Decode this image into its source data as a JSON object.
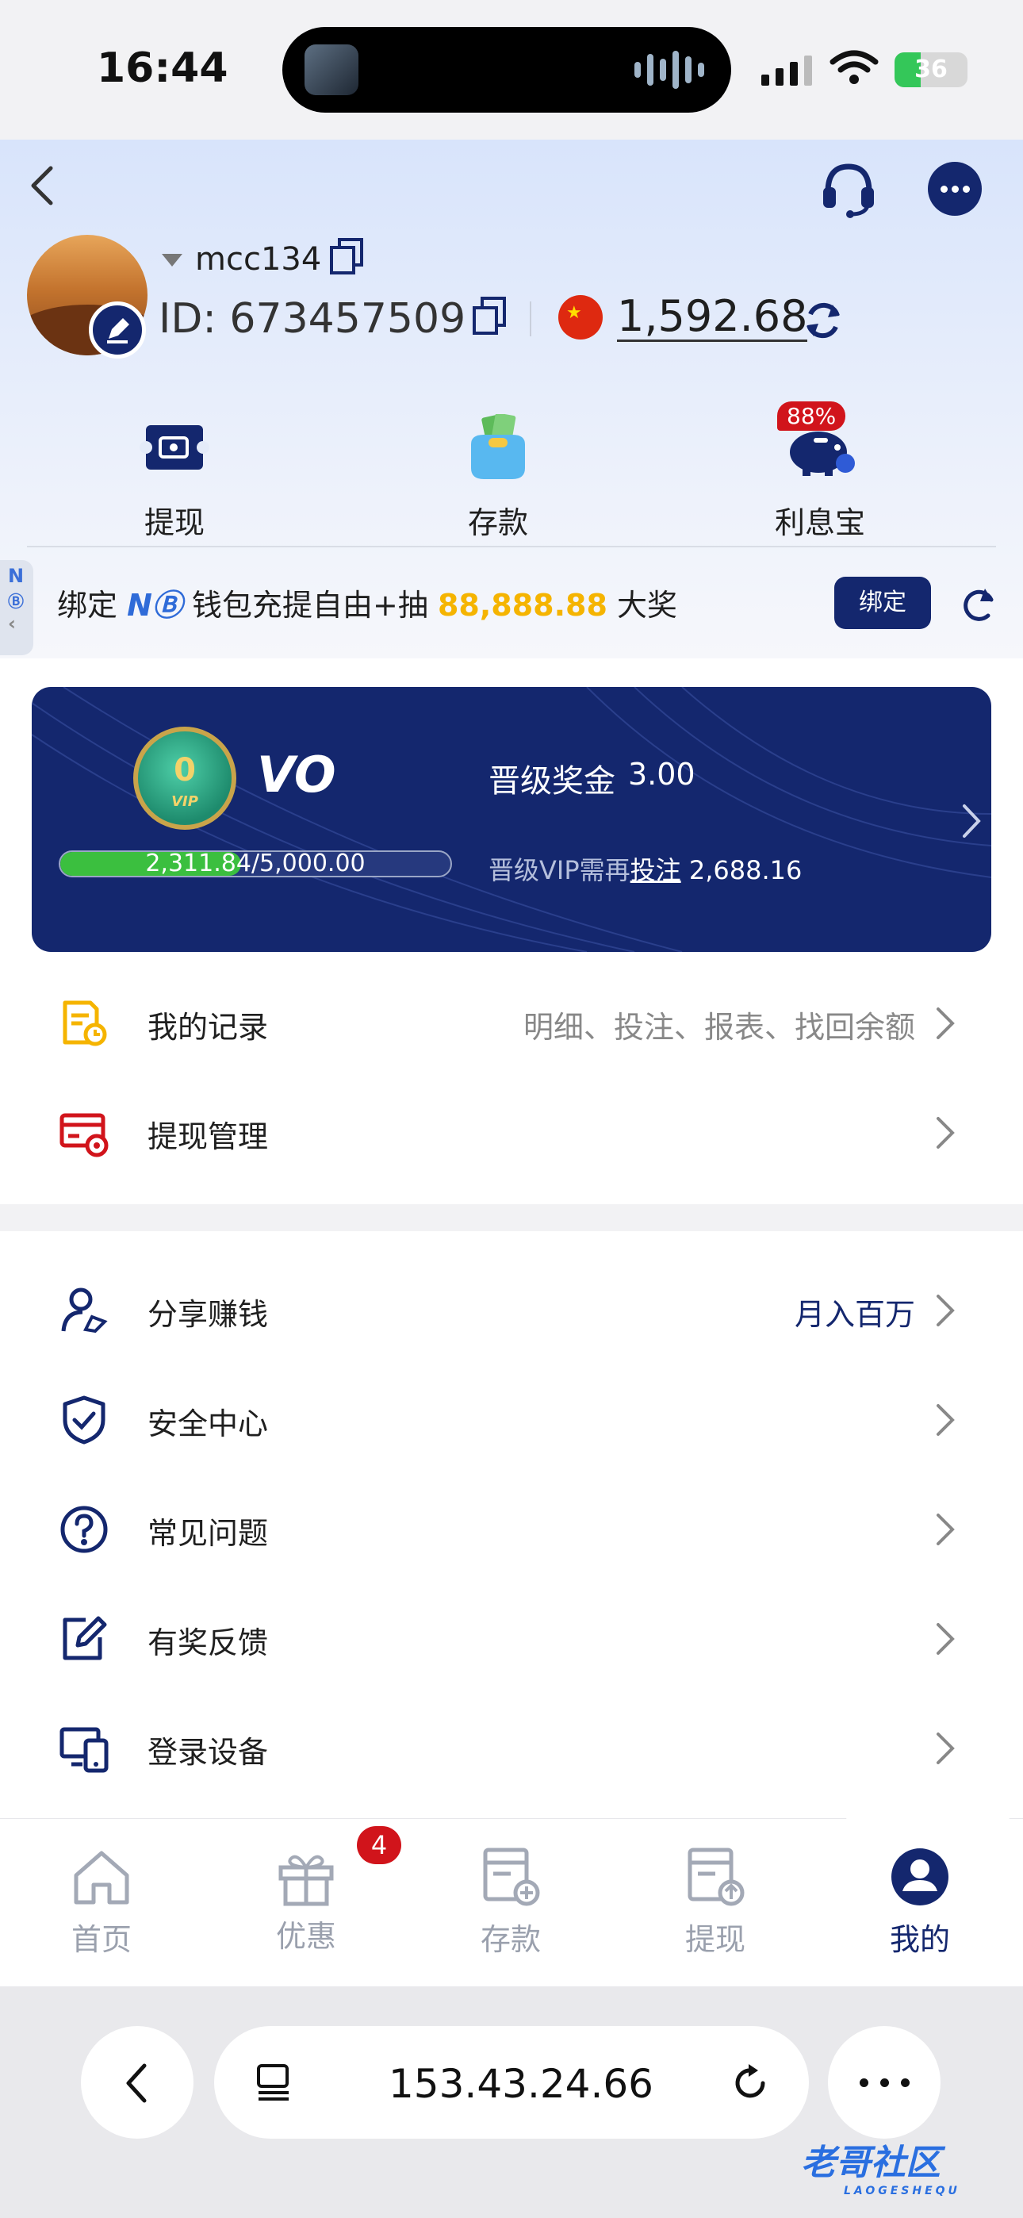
{
  "status": {
    "time": "16:44",
    "battery": "36"
  },
  "header": {
    "username": "mcc134",
    "id_text": "ID: 673457509",
    "balance": "1,592.68",
    "quick_actions": [
      {
        "label": "提现",
        "icon": "withdraw-ticket-icon"
      },
      {
        "label": "存款",
        "icon": "deposit-wallet-icon"
      },
      {
        "label": "利息宝",
        "icon": "piggy-bank-icon",
        "badge": "88%"
      }
    ],
    "promo": {
      "prefix": "绑定",
      "brand": "N",
      "middle": "钱包充提自由+抽",
      "amount": "88,888.88",
      "suffix": "大奖",
      "bind_label": "绑定"
    },
    "side_tab": "N"
  },
  "vip": {
    "medal_number": "0",
    "medal_text": "VIP",
    "level": "VO",
    "progress_text": "2,311.84/5,000.00",
    "progress_value": 0.4624,
    "bonus_label": "晋级奖金",
    "bonus_value": "3.00",
    "need_prefix": "晋级VIP需再",
    "need_link": "投注",
    "need_value": "2,688.16"
  },
  "menu_group_1": [
    {
      "label": "我的记录",
      "hint": "明细、投注、报表、找回余额",
      "icon": "records-icon"
    },
    {
      "label": "提现管理",
      "hint": "",
      "icon": "withdraw-manage-icon"
    }
  ],
  "menu_group_2": [
    {
      "label": "分享赚钱",
      "hint": "月入百万",
      "icon": "share-earn-icon"
    },
    {
      "label": "安全中心",
      "hint": "",
      "icon": "shield-check-icon"
    },
    {
      "label": "常见问题",
      "hint": "",
      "icon": "question-icon"
    },
    {
      "label": "有奖反馈",
      "hint": "",
      "icon": "feedback-edit-icon"
    },
    {
      "label": "登录设备",
      "hint": "",
      "icon": "devices-icon"
    }
  ],
  "tabbar": [
    {
      "label": "首页",
      "icon": "home-icon"
    },
    {
      "label": "优惠",
      "icon": "gift-icon",
      "badge": "4"
    },
    {
      "label": "存款",
      "icon": "deposit-card-icon"
    },
    {
      "label": "提现",
      "icon": "withdraw-card-icon"
    },
    {
      "label": "我的",
      "icon": "profile-icon",
      "active": true
    }
  ],
  "browser": {
    "url": "153.43.24.66"
  },
  "watermark": {
    "title": "老哥社区",
    "subtitle": "LAOGESHEQU"
  },
  "colors": {
    "brand_navy": "#14276e",
    "gold": "#f5b400",
    "badge_red": "#d1141b",
    "progress_green": "#3bbf3f"
  }
}
